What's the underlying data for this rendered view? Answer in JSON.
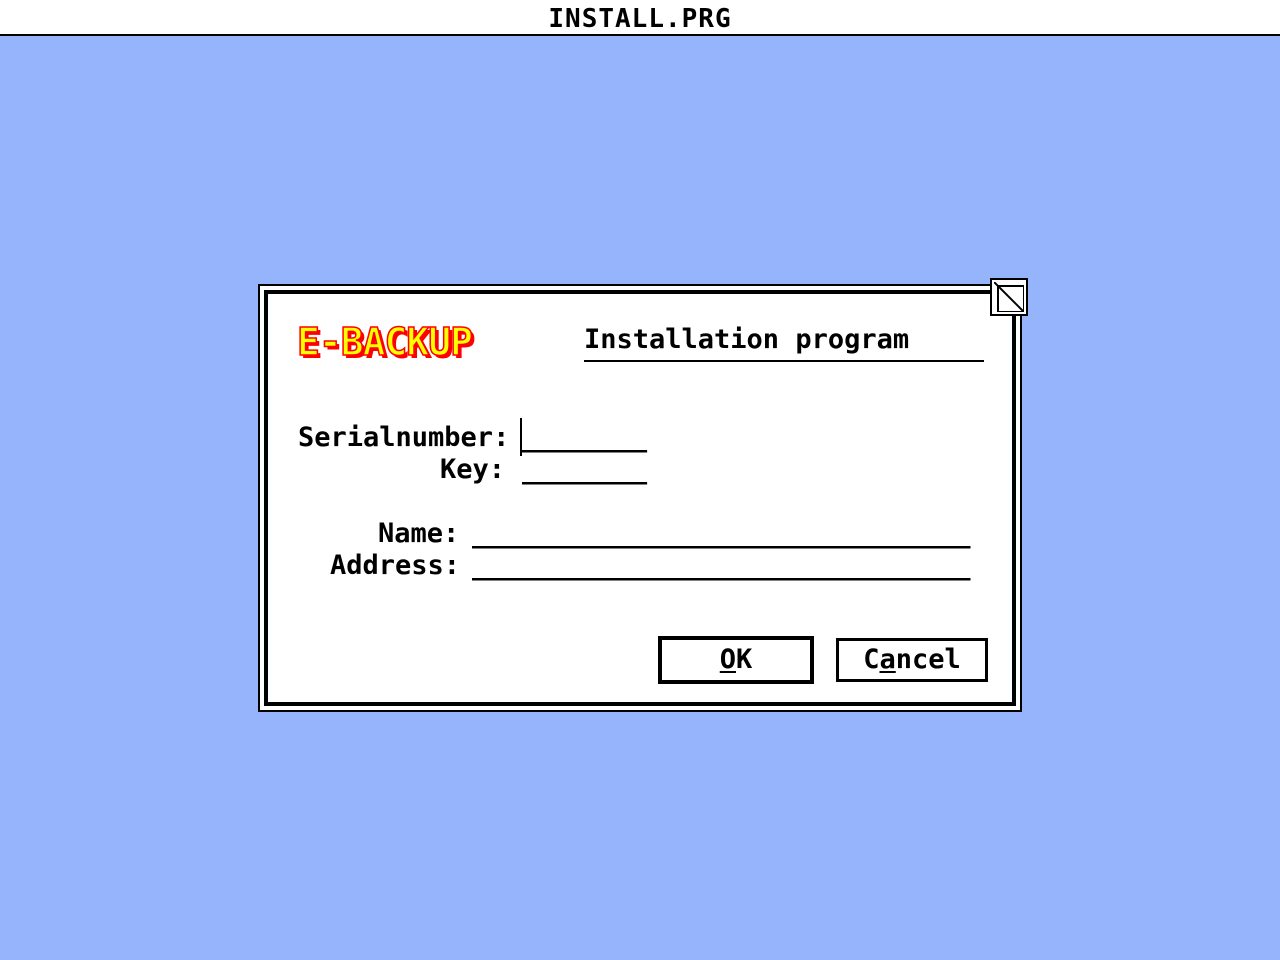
{
  "menubar": {
    "title": "INSTALL.PRG"
  },
  "dialog": {
    "logo_text": "E-BACKUP",
    "heading": "Installation program",
    "fields": {
      "serial": {
        "label": "Serialnumber:",
        "value": "________"
      },
      "key": {
        "label": "Key:",
        "value": "________"
      },
      "name": {
        "label": "Name:",
        "value": "________________________________"
      },
      "address": {
        "label": "Address:",
        "value": "________________________________"
      }
    },
    "buttons": {
      "ok": {
        "label_underlined": "O",
        "label_rest": "K"
      },
      "cancel": {
        "label_pre": "C",
        "label_underlined": "a",
        "label_rest": "ncel"
      }
    }
  },
  "colors": {
    "desktop": "#96b4fc",
    "window": "#ffffff",
    "logo_fill": "#ffff00",
    "logo_outline": "#ff0000"
  },
  "icons": {
    "resize": "resize-corner-icon"
  }
}
